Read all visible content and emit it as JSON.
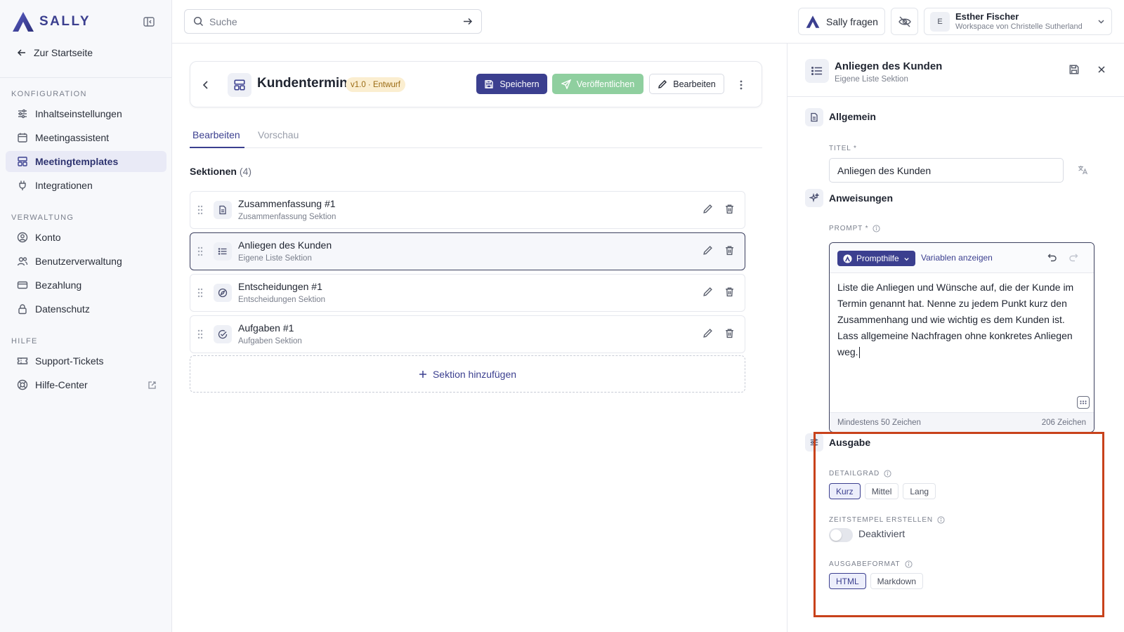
{
  "brand": {
    "name": "SALLY",
    "color": "#3b3f8f"
  },
  "sidebar": {
    "back_label": "Zur Startseite",
    "groups": [
      {
        "label": "KONFIGURATION",
        "items": [
          {
            "label": "Inhaltseinstellungen",
            "icon": "sliders-icon"
          },
          {
            "label": "Meetingassistent",
            "icon": "calendar-icon"
          },
          {
            "label": "Meetingtemplates",
            "icon": "template-icon",
            "active": true
          },
          {
            "label": "Integrationen",
            "icon": "plug-icon"
          }
        ]
      },
      {
        "label": "VERWALTUNG",
        "items": [
          {
            "label": "Konto",
            "icon": "user-circle-icon"
          },
          {
            "label": "Benutzerverwaltung",
            "icon": "users-icon"
          },
          {
            "label": "Bezahlung",
            "icon": "credit-card-icon"
          },
          {
            "label": "Datenschutz",
            "icon": "lock-icon"
          }
        ]
      },
      {
        "label": "HILFE",
        "items": [
          {
            "label": "Support-Tickets",
            "icon": "ticket-icon"
          },
          {
            "label": "Hilfe-Center",
            "icon": "lifebuoy-icon",
            "external": true
          }
        ]
      }
    ]
  },
  "topbar": {
    "search_placeholder": "Suche",
    "ask_sally_label": "Sally fragen",
    "user": {
      "initial": "E",
      "name": "Esther Fischer",
      "workspace": "Workspace von Christelle Sutherland"
    }
  },
  "template": {
    "title": "Kundentermin",
    "badge": "v1.0 · Entwurf",
    "save_label": "Speichern",
    "publish_label": "Veröffentlichen",
    "edit_label": "Bearbeiten"
  },
  "tabs": [
    {
      "label": "Bearbeiten",
      "active": true
    },
    {
      "label": "Vorschau",
      "active": false
    }
  ],
  "sections": {
    "heading": "Sektionen",
    "count": "(4)",
    "items": [
      {
        "title": "Zusammenfassung #1",
        "subtitle": "Zusammenfassung Sektion",
        "icon": "document-icon"
      },
      {
        "title": "Anliegen des Kunden",
        "subtitle": "Eigene Liste Sektion",
        "icon": "list-icon",
        "selected": true
      },
      {
        "title": "Entscheidungen #1",
        "subtitle": "Entscheidungen Sektion",
        "icon": "compass-icon"
      },
      {
        "title": "Aufgaben #1",
        "subtitle": "Aufgaben Sektion",
        "icon": "check-circle-icon"
      }
    ],
    "add_label": "Sektion hinzufügen"
  },
  "panel": {
    "title": "Anliegen des Kunden",
    "subtitle": "Eigene Liste Sektion",
    "general": {
      "heading": "Allgemein",
      "title_label": "TITEL *",
      "title_value": "Anliegen des Kunden"
    },
    "instructions": {
      "heading": "Anweisungen",
      "prompt_label": "PROMPT *",
      "prompthilfe_label": "Prompthilfe",
      "variables_label": "Variablen anzeigen",
      "prompt_text": "Liste die Anliegen und Wünsche auf, die der Kunde im Termin genannt hat. Nenne zu jedem Punkt kurz den Zusammenhang und wie wichtig es dem Kunden ist. Lass allgemeine Nachfragen ohne konkretes Anliegen weg.",
      "min_chars": "Mindestens 50 Zeichen",
      "char_count": "206 Zeichen"
    },
    "output": {
      "heading": "Ausgabe",
      "detail_label": "DETAILGRAD",
      "detail_options": [
        "Kurz",
        "Mittel",
        "Lang"
      ],
      "detail_selected": "Kurz",
      "timestamps_label": "ZEITSTEMPEL ERSTELLEN",
      "timestamps_state": "Deaktiviert",
      "format_label": "AUSGABEFORMAT",
      "format_options": [
        "HTML",
        "Markdown"
      ],
      "format_selected": "HTML"
    }
  },
  "colors": {
    "accent": "#3b3f8f",
    "publish": "#8fcf9f",
    "badge_bg": "#fbeed0",
    "highlight": "#c8421b"
  }
}
